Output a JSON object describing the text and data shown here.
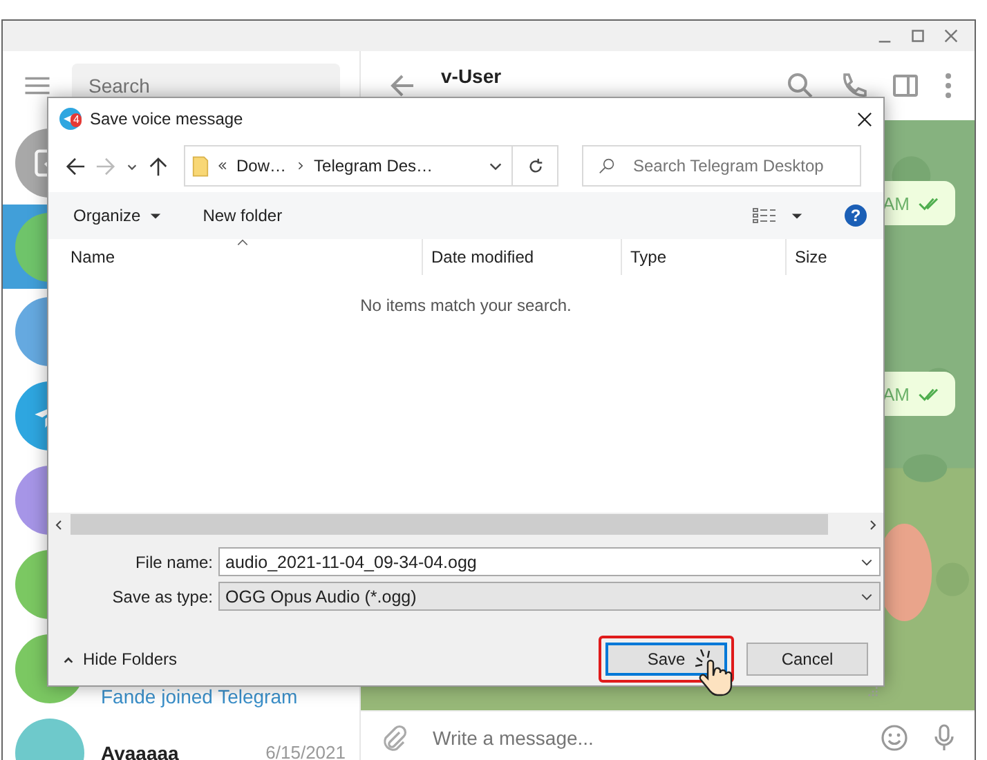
{
  "sidebar": {
    "search": {
      "placeholder": "Search"
    },
    "chats": [
      {
        "kind": "archive",
        "color": "#a8a8a8",
        "selected": false
      },
      {
        "kind": "plain",
        "color": "#6fc46a",
        "selected": true
      },
      {
        "kind": "plain",
        "color": "#65a9e0",
        "selected": false
      },
      {
        "kind": "telegram",
        "color": "#2ea6e0",
        "selected": false
      },
      {
        "kind": "plain",
        "color": "#a695e7",
        "selected": false
      },
      {
        "kind": "plain",
        "color": "#7bc862",
        "selected": false
      },
      {
        "kind": "plain",
        "color": "#7bc862",
        "selected": false,
        "preview": "Fande joined Telegram"
      },
      {
        "kind": "plain",
        "color": "#6ec9cb",
        "selected": false,
        "name": "Avaaaaa",
        "date": "6/15/2021"
      }
    ]
  },
  "chat": {
    "name": "v-User",
    "messages": [
      {
        "time": "AM"
      },
      {
        "time": "AM"
      }
    ],
    "composer": {
      "placeholder": "Write a message..."
    }
  },
  "dialog": {
    "title": "Save voice message",
    "badge": "4",
    "path": [
      "Dow…",
      "Telegram Des…"
    ],
    "search": {
      "placeholder": "Search Telegram Desktop"
    },
    "toolbar": [
      "Organize",
      "New folder"
    ],
    "help": "?",
    "columns": [
      "Name",
      "Date modified",
      "Type",
      "Size"
    ],
    "empty_message": "No items match your search.",
    "file_name": {
      "label": "File name:",
      "value": "audio_2021-11-04_09-34-04.ogg"
    },
    "save_type": {
      "label": "Save as type:",
      "value": "OGG Opus Audio (*.ogg)"
    },
    "hide_folders": "Hide Folders",
    "buttons": [
      {
        "label": "Save",
        "focused": true
      },
      {
        "label": "Cancel",
        "focused": false
      }
    ]
  }
}
